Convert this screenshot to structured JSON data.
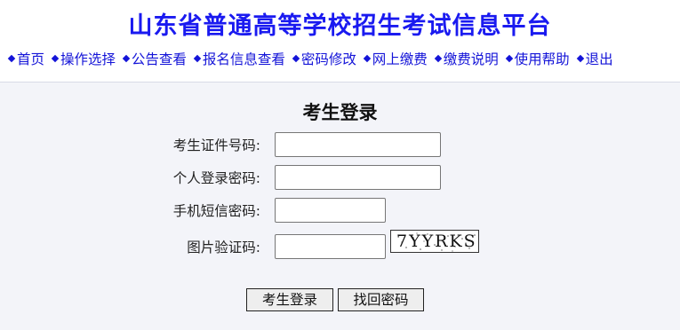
{
  "header": {
    "title": "山东省普通高等学校招生考试信息平台",
    "nav": [
      {
        "label": "首页"
      },
      {
        "label": "操作选择"
      },
      {
        "label": "公告查看"
      },
      {
        "label": "报名信息查看"
      },
      {
        "label": "密码修改"
      },
      {
        "label": "网上缴费"
      },
      {
        "label": "缴费说明"
      },
      {
        "label": "使用帮助"
      },
      {
        "label": "退出"
      }
    ]
  },
  "login": {
    "title": "考生登录",
    "fields": {
      "id_number": {
        "label": "考生证件号码:",
        "value": ""
      },
      "password": {
        "label": "个人登录密码:",
        "value": ""
      },
      "sms_code": {
        "label": "手机短信密码:",
        "value": ""
      },
      "captcha": {
        "label": "图片验证码:",
        "value": "",
        "image_text": "7YYRKS"
      }
    },
    "buttons": {
      "login": "考生登录",
      "recover": "找回密码"
    }
  },
  "colors": {
    "title": "#1a1af0",
    "nav_link": "#1414d8",
    "background": "#f3f4f9"
  }
}
